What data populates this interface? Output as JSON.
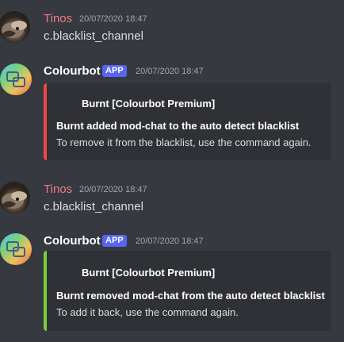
{
  "colors": {
    "background": "#36393f",
    "embed_bg": "#2f3136",
    "tinos_name": "#ee7a8a",
    "app_badge": "#5865f2",
    "embed_red": "#f04747",
    "embed_green": "#7ad03a"
  },
  "messages": [
    {
      "author": "Tinos",
      "timestamp": "20/07/2020 18:47",
      "content": "c.blacklist_channel"
    },
    {
      "author": "Colourbot",
      "badge": "APP",
      "timestamp": "20/07/2020 18:47",
      "embed": {
        "author": "Burnt [Colourbot Premium]",
        "title": "Burnt added mod-chat to the auto detect blacklist",
        "description": "To remove it from the blacklist, use the command again."
      }
    },
    {
      "author": "Tinos",
      "timestamp": "20/07/2020 18:47",
      "content": "c.blacklist_channel"
    },
    {
      "author": "Colourbot",
      "badge": "APP",
      "timestamp": "20/07/2020 18:47",
      "embed": {
        "author": "Burnt [Colourbot Premium]",
        "title": "Burnt removed mod-chat from the auto detect blacklist",
        "description": "To add it back, use the command again."
      }
    }
  ]
}
